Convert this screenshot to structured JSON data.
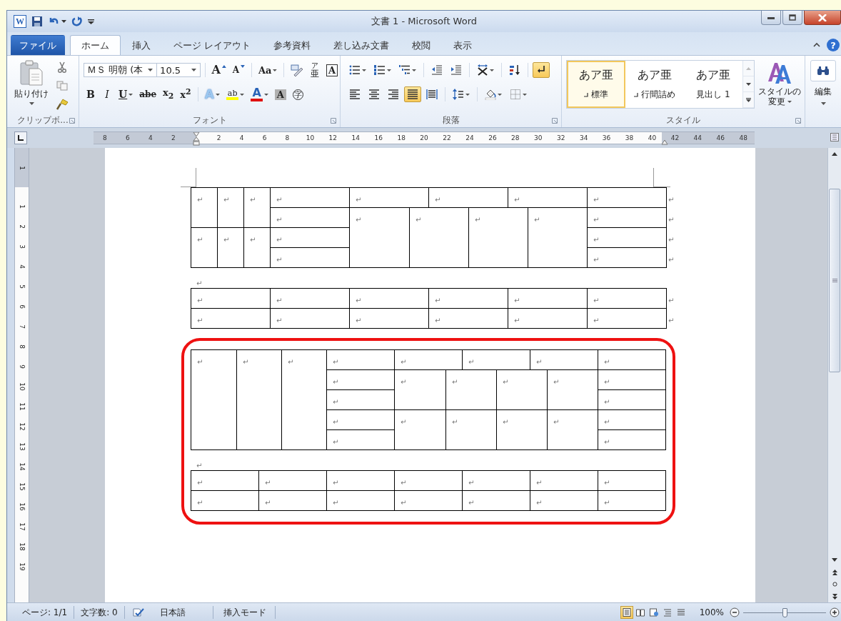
{
  "window": {
    "app_letter": "W",
    "title": "文書 1 - Microsoft Word"
  },
  "tabs": [
    {
      "label": "ファイル",
      "kind": "file",
      "selected": false
    },
    {
      "label": "ホーム",
      "kind": "tab",
      "selected": true
    },
    {
      "label": "挿入",
      "kind": "tab",
      "selected": false
    },
    {
      "label": "ページ レイアウト",
      "kind": "tab",
      "selected": false
    },
    {
      "label": "参考資料",
      "kind": "tab",
      "selected": false
    },
    {
      "label": "差し込み文書",
      "kind": "tab",
      "selected": false
    },
    {
      "label": "校閲",
      "kind": "tab",
      "selected": false
    },
    {
      "label": "表示",
      "kind": "tab",
      "selected": false
    }
  ],
  "help": "?",
  "ribbon": {
    "clipboard": {
      "paste_label": "貼り付け",
      "group_label": "クリップボ..."
    },
    "font": {
      "font_name": "ＭＳ 明朝 (本",
      "font_size": "10.5",
      "group_label": "フォント",
      "row1": [
        [
          {
            "kind": "grow",
            "label": "A"
          },
          {
            "kind": "shrink",
            "label": "A"
          }
        ],
        [
          {
            "kind": "case",
            "label": "Aa",
            "dropdown": true
          }
        ],
        [
          {
            "kind": "phonetic"
          },
          {
            "kind": "ruby",
            "label": "亜",
            "ruby": "ア"
          },
          {
            "kind": "boxed",
            "label": "A"
          }
        ]
      ],
      "row2": [
        [
          {
            "kind": "bold",
            "label": "B",
            "on": false
          },
          {
            "kind": "italic",
            "label": "I",
            "on": false
          },
          {
            "kind": "underline",
            "label": "U",
            "dropdown": true,
            "on": false
          },
          {
            "kind": "strike",
            "label": "abe",
            "on": false
          },
          {
            "kind": "sub",
            "label": "x$_{2}$",
            "on": false
          },
          {
            "kind": "sup",
            "label": "x$^{2}$",
            "on": false
          }
        ],
        [
          {
            "kind": "effects",
            "label": "A",
            "dropdown": true
          },
          {
            "kind": "highlight",
            "label": "ab",
            "dropdown": true
          },
          {
            "kind": "color",
            "label": "A",
            "dropdown": true
          },
          {
            "kind": "shade",
            "label": "A"
          },
          {
            "kind": "enclose",
            "label": "字"
          }
        ]
      ]
    },
    "paragraph": {
      "group_label": "段落",
      "row1": [
        [
          {
            "kind": "bullets",
            "dropdown": true
          },
          {
            "kind": "numbering",
            "dropdown": true
          },
          {
            "kind": "multilevel",
            "dropdown": true
          }
        ],
        [
          {
            "kind": "outdent"
          },
          {
            "kind": "indent"
          }
        ],
        [
          {
            "kind": "asian",
            "dropdown": true
          }
        ],
        [
          {
            "kind": "sort"
          }
        ],
        [
          {
            "kind": "marks",
            "on": true
          }
        ]
      ],
      "row2": [
        [
          {
            "kind": "left",
            "selected": false
          },
          {
            "kind": "center",
            "selected": false
          },
          {
            "kind": "right",
            "selected": false
          },
          {
            "kind": "justify",
            "selected": true
          },
          {
            "kind": "distributed",
            "selected": false
          }
        ],
        [
          {
            "kind": "spacing",
            "dropdown": true
          }
        ],
        [
          {
            "kind": "shading",
            "dropdown": true
          },
          {
            "kind": "borders",
            "dropdown": true
          }
        ]
      ]
    },
    "styles": {
      "group_label": "スタイル",
      "change_label": "スタイルの変更",
      "items": [
        {
          "sample": "あア亜",
          "label": "標準",
          "linked": true,
          "selected": true
        },
        {
          "sample": "あア亜",
          "label": "行間詰め",
          "linked": true,
          "selected": false
        },
        {
          "sample": "あア亜",
          "label": "見出し 1",
          "linked": false,
          "selected": false
        }
      ]
    },
    "editing": {
      "label": "編集"
    }
  },
  "ruler": {
    "numbers": [
      "8",
      "6",
      "4",
      "2",
      "2",
      "4",
      "6",
      "8",
      "10",
      "12",
      "14",
      "16",
      "18",
      "20",
      "22",
      "24",
      "26",
      "28",
      "30",
      "32",
      "34",
      "36",
      "38",
      "40",
      "42",
      "44",
      "46",
      "48"
    ]
  },
  "vertical_ruler": {
    "top_number": "1",
    "numbers": [
      "1",
      "2",
      "3",
      "4",
      "5",
      "6",
      "7",
      "8",
      "9",
      "10",
      "11",
      "12",
      "13",
      "14",
      "15",
      "16",
      "17",
      "18",
      "19"
    ]
  },
  "document": {
    "blocks": [
      {
        "kind": "table",
        "rows": [
          {
            "end": "↵",
            "cells": [
              {
                "text": "↵",
                "rowspan": 2
              },
              {
                "text": "↵",
                "rowspan": 2
              },
              {
                "text": "↵",
                "rowspan": 2
              },
              {
                "text": "↵"
              },
              {
                "text": "↵",
                "colspan": 2
              },
              {
                "text": "↵",
                "colspan": 2
              },
              {
                "text": "↵",
                "colspan": 2
              },
              {
                "text": "↵"
              }
            ]
          },
          {
            "end": "↵",
            "cells": [
              {
                "text": "↵"
              },
              {
                "text": "↵",
                "rowspan": 3
              },
              {
                "text": "↵",
                "rowspan": 3,
                "colspan": 2
              },
              {
                "text": "↵",
                "rowspan": 3,
                "colspan": 2
              },
              {
                "text": "↵",
                "rowspan": 3
              },
              {
                "text": "↵"
              }
            ]
          },
          {
            "end": "↵",
            "cells": [
              {
                "text": "↵",
                "rowspan": 2
              },
              {
                "text": "↵",
                "rowspan": 2
              },
              {
                "text": "↵",
                "rowspan": 2
              },
              {
                "text": "↵"
              },
              {
                "text": "↵"
              }
            ]
          },
          {
            "end": "↵",
            "cells": [
              {
                "text": "↵"
              },
              {
                "text": "↵"
              }
            ]
          }
        ]
      },
      {
        "kind": "paragraph",
        "mark": "↵"
      },
      {
        "kind": "table",
        "rows": [
          {
            "end": "↵",
            "cells": [
              {
                "text": "↵"
              },
              {
                "text": "↵"
              },
              {
                "text": "↵"
              },
              {
                "text": "↵"
              },
              {
                "text": "↵"
              },
              {
                "text": "↵"
              }
            ]
          },
          {
            "end": "↵",
            "cells": [
              {
                "text": "↵"
              },
              {
                "text": "↵"
              },
              {
                "text": "↵"
              },
              {
                "text": "↵"
              },
              {
                "text": "↵"
              },
              {
                "text": "↵"
              }
            ]
          }
        ]
      },
      {
        "kind": "highlight",
        "blocks": [
          {
            "kind": "table",
            "rows": [
              {
                "cells": [
                  {
                    "text": "↵",
                    "rowspan": 5
                  },
                  {
                    "text": "↵",
                    "rowspan": 5
                  },
                  {
                    "text": "↵",
                    "rowspan": 5
                  },
                  {
                    "text": "↵"
                  },
                  {
                    "text": "↵",
                    "colspan": 2
                  },
                  {
                    "text": "↵",
                    "colspan": 2
                  },
                  {
                    "text": "↵",
                    "colspan": 2
                  },
                  {
                    "text": "↵"
                  }
                ]
              },
              {
                "cells": [
                  {
                    "text": "↵"
                  },
                  {
                    "text": "↵",
                    "rowspan": 2
                  },
                  {
                    "text": "↵",
                    "rowspan": 2,
                    "colspan": 2
                  },
                  {
                    "text": "↵",
                    "rowspan": 2,
                    "colspan": 2
                  },
                  {
                    "text": "↵",
                    "rowspan": 2
                  },
                  {
                    "text": "↵"
                  }
                ]
              },
              {
                "cells": [
                  {
                    "text": "↵"
                  },
                  {
                    "text": "↵"
                  }
                ]
              },
              {
                "cells": [
                  {
                    "text": "↵"
                  },
                  {
                    "text": "↵",
                    "rowspan": 2
                  },
                  {
                    "text": "↵",
                    "rowspan": 2,
                    "colspan": 2
                  },
                  {
                    "text": "↵",
                    "rowspan": 2,
                    "colspan": 2
                  },
                  {
                    "text": "↵",
                    "rowspan": 2
                  },
                  {
                    "text": "↵"
                  }
                ]
              },
              {
                "cells": [
                  {
                    "text": "↵"
                  },
                  {
                    "text": "↵"
                  }
                ]
              }
            ]
          },
          {
            "kind": "paragraph",
            "mark": "↵"
          },
          {
            "kind": "table",
            "rows": [
              {
                "cells": [
                  {
                    "text": "↵"
                  },
                  {
                    "text": "↵"
                  },
                  {
                    "text": "↵"
                  },
                  {
                    "text": "↵"
                  },
                  {
                    "text": "↵"
                  },
                  {
                    "text": "↵"
                  },
                  {
                    "text": "↵"
                  }
                ]
              },
              {
                "cells": [
                  {
                    "text": "↵"
                  },
                  {
                    "text": "↵"
                  },
                  {
                    "text": "↵"
                  },
                  {
                    "text": "↵"
                  },
                  {
                    "text": "↵"
                  },
                  {
                    "text": "↵"
                  },
                  {
                    "text": "↵"
                  }
                ]
              }
            ]
          }
        ]
      }
    ]
  },
  "status_bar": {
    "page": "ページ: 1/1",
    "words": "文字数: 0",
    "language": "日本語",
    "mode": "挿入モード",
    "views": [
      {
        "kind": "print",
        "selected": true
      },
      {
        "kind": "reading",
        "selected": false
      },
      {
        "kind": "web",
        "selected": false
      },
      {
        "kind": "outline",
        "selected": false
      },
      {
        "kind": "draft",
        "selected": false
      }
    ],
    "zoom": "100%",
    "zoom_slider": {
      "level": 0.5
    }
  }
}
